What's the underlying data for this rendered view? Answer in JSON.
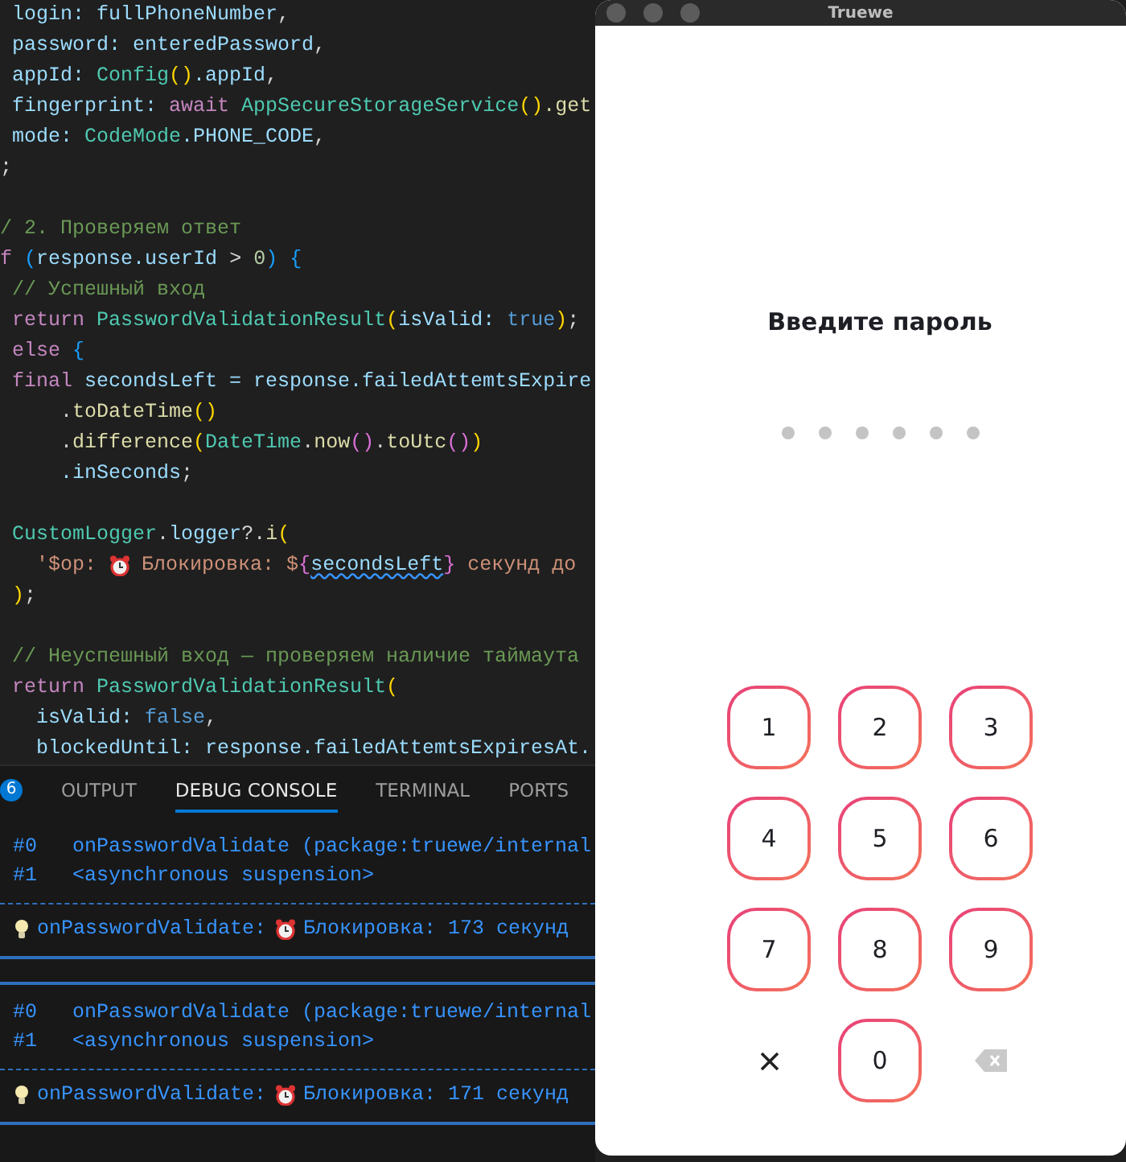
{
  "editor": {
    "code_blocks": [
      [
        [
          {
            "t": " login: fullPhoneNumber",
            "kind": "var"
          },
          {
            "t": ",",
            "kind": "plain"
          }
        ],
        [
          {
            "t": " password: enteredPassword",
            "kind": "var"
          },
          {
            "t": ",",
            "kind": "plain"
          }
        ],
        [
          {
            "t": " appId: ",
            "kind": "var"
          },
          {
            "t": "Config",
            "kind": "type"
          },
          {
            "t": "()",
            "kind": "br1"
          },
          {
            "t": ".appId",
            "kind": "var"
          },
          {
            "t": ",",
            "kind": "plain"
          }
        ],
        [
          {
            "t": " fingerprint: ",
            "kind": "var"
          },
          {
            "t": "await ",
            "kind": "kw"
          },
          {
            "t": "AppSecureStorageService",
            "kind": "type"
          },
          {
            "t": "()",
            "kind": "br1"
          },
          {
            "t": ".get",
            "kind": "fn"
          }
        ],
        [
          {
            "t": " mode: ",
            "kind": "var"
          },
          {
            "t": "CodeMode",
            "kind": "type"
          },
          {
            "t": ".PHONE_CODE",
            "kind": "var"
          },
          {
            "t": ",",
            "kind": "plain"
          }
        ],
        [
          {
            "t": ";",
            "kind": "plain"
          }
        ]
      ],
      [
        [
          {
            "t": "/ 2. Проверяем ответ",
            "kind": "comment"
          }
        ],
        [
          {
            "t": "f ",
            "kind": "kw"
          },
          {
            "t": "(",
            "kind": "br3"
          },
          {
            "t": "response.userId",
            "kind": "var"
          },
          {
            "t": " > ",
            "kind": "plain"
          },
          {
            "t": "0",
            "kind": "num"
          },
          {
            "t": ")",
            "kind": "br3"
          },
          {
            "t": " {",
            "kind": "br3"
          }
        ],
        [
          {
            "t": " // Успешный вход",
            "kind": "comment"
          }
        ],
        [
          {
            "t": " return ",
            "kind": "kw"
          },
          {
            "t": "PasswordValidationResult",
            "kind": "type"
          },
          {
            "t": "(",
            "kind": "br1"
          },
          {
            "t": "isValid: ",
            "kind": "var"
          },
          {
            "t": "true",
            "kind": "bool"
          },
          {
            "t": ")",
            "kind": "br1"
          },
          {
            "t": ";",
            "kind": "plain"
          }
        ],
        [
          {
            "t": " else",
            "kind": "kw"
          },
          {
            "t": " {",
            "kind": "br3"
          }
        ],
        [
          {
            "t": " final",
            "kind": "kw"
          },
          {
            "t": " secondsLeft = response.failedAttemtsExpire",
            "kind": "var"
          }
        ],
        [
          {
            "t": "     .",
            "kind": "plain"
          },
          {
            "t": "toDateTime",
            "kind": "fn"
          },
          {
            "t": "()",
            "kind": "br1"
          }
        ],
        [
          {
            "t": "     .",
            "kind": "plain"
          },
          {
            "t": "difference",
            "kind": "fn"
          },
          {
            "t": "(",
            "kind": "br1"
          },
          {
            "t": "DateTime",
            "kind": "type"
          },
          {
            "t": ".",
            "kind": "plain"
          },
          {
            "t": "now",
            "kind": "fn"
          },
          {
            "t": "()",
            "kind": "br2"
          },
          {
            "t": ".",
            "kind": "plain"
          },
          {
            "t": "toUtc",
            "kind": "fn"
          },
          {
            "t": "()",
            "kind": "br2"
          },
          {
            "t": ")",
            "kind": "br1"
          }
        ],
        [
          {
            "t": "     .inSeconds",
            "kind": "var"
          },
          {
            "t": ";",
            "kind": "plain"
          }
        ]
      ],
      [
        [
          {
            "t": " CustomLogger",
            "kind": "type"
          },
          {
            "t": ".",
            "kind": "plain"
          },
          {
            "t": "logger",
            "kind": "var"
          },
          {
            "t": "?.",
            "kind": "plain"
          },
          {
            "t": "i",
            "kind": "fn"
          },
          {
            "t": "(",
            "kind": "br1"
          }
        ],
        [
          {
            "t": "   '$op: ",
            "kind": "string"
          },
          {
            "kind": "clock"
          },
          {
            "t": " Блокировка: $",
            "kind": "string"
          },
          {
            "t": "{",
            "kind": "br2"
          },
          {
            "t": "secondsLeft",
            "kind": "warn"
          },
          {
            "t": "}",
            "kind": "br2"
          },
          {
            "t": " секунд до",
            "kind": "string"
          }
        ],
        [
          {
            "t": " )",
            "kind": "br1"
          },
          {
            "t": ";",
            "kind": "plain"
          }
        ]
      ],
      [
        [
          {
            "t": " // Неуспешный вход — проверяем наличие таймаута",
            "kind": "comment"
          }
        ],
        [
          {
            "t": " return ",
            "kind": "kw"
          },
          {
            "t": "PasswordValidationResult",
            "kind": "type"
          },
          {
            "t": "(",
            "kind": "br1"
          }
        ],
        [
          {
            "t": "   isValid: ",
            "kind": "var"
          },
          {
            "t": "false",
            "kind": "bool"
          },
          {
            "t": ",",
            "kind": "plain"
          }
        ],
        [
          {
            "t": "   blockedUntil: response.failedAttemtsExpiresAt.",
            "kind": "var"
          }
        ]
      ]
    ]
  },
  "panel": {
    "badge": "6",
    "tabs": [
      {
        "label": "OUTPUT",
        "selected": false
      },
      {
        "label": "DEBUG CONSOLE",
        "selected": true
      },
      {
        "label": "TERMINAL",
        "selected": false
      },
      {
        "label": "PORTS",
        "selected": false
      }
    ],
    "entries": [
      {
        "frames": [
          {
            "index": "#0",
            "text": "onPasswordValidate (package:truewe/internal"
          },
          {
            "index": "#1",
            "text": "<asynchronous suspension>"
          }
        ],
        "log": {
          "prefix": "onPasswordValidate:",
          "message": "Блокировка: 173 секунд"
        }
      },
      {
        "frames": [
          {
            "index": "#0",
            "text": "onPasswordValidate (package:truewe/internal"
          },
          {
            "index": "#1",
            "text": "<asynchronous suspension>"
          }
        ],
        "log": {
          "prefix": "onPasswordValidate:",
          "message": "Блокировка: 171 секунд"
        }
      }
    ]
  },
  "app": {
    "title": "Truewe",
    "heading": "Введите пароль",
    "pin_dots": [
      {
        "filled": false
      },
      {
        "filled": false
      },
      {
        "filled": false
      },
      {
        "filled": false
      },
      {
        "filled": false
      },
      {
        "filled": false
      }
    ],
    "keys": [
      {
        "kind": "digit",
        "label": "1"
      },
      {
        "kind": "digit",
        "label": "2"
      },
      {
        "kind": "digit",
        "label": "3"
      },
      {
        "kind": "digit",
        "label": "4"
      },
      {
        "kind": "digit",
        "label": "5"
      },
      {
        "kind": "digit",
        "label": "6"
      },
      {
        "kind": "digit",
        "label": "7"
      },
      {
        "kind": "digit",
        "label": "8"
      },
      {
        "kind": "digit",
        "label": "9"
      },
      {
        "kind": "cancel"
      },
      {
        "kind": "digit",
        "label": "0"
      },
      {
        "kind": "backspace"
      }
    ]
  }
}
